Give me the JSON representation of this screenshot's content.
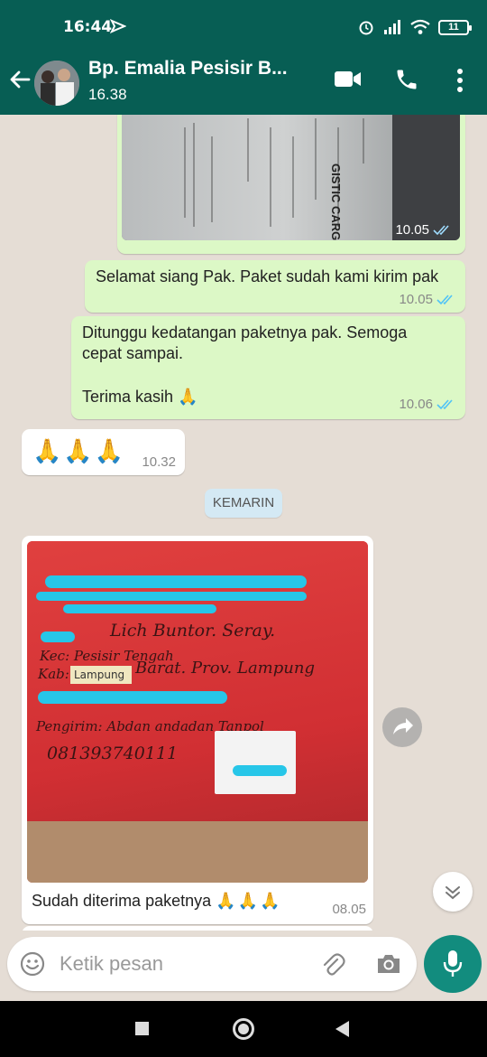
{
  "status_bar": {
    "time": "16:44",
    "battery": "11"
  },
  "header": {
    "contact_name": "Bp. Emalia Pesisir B...",
    "last_seen": "16.38"
  },
  "messages": [
    {
      "id": "doc-image",
      "direction": "out",
      "image": "shipping-document-photo",
      "doc_caption": "GISTIC CARGO",
      "time": "10.05",
      "ticks": "read"
    },
    {
      "id": "m1",
      "direction": "out",
      "text": "Selamat siang Pak. Paket sudah kami kirim pak",
      "time": "10.05",
      "ticks": "read"
    },
    {
      "id": "m2",
      "direction": "out",
      "text_line1": "Ditunggu kedatangan paketnya pak. Semoga",
      "text_line2": "cepat sampai.",
      "text_line3": "Terima kasih",
      "emoji": "🙏",
      "time": "10.06",
      "ticks": "read"
    },
    {
      "id": "m3",
      "direction": "in",
      "emoji": "🙏🙏🙏",
      "time": "10.32"
    },
    {
      "id": "m4",
      "direction": "in",
      "image": "red-parcel-photo",
      "caption": "Sudah diterima paketnya",
      "emoji": "🙏🙏🙏",
      "time": "08.05"
    }
  ],
  "date_separator": "KEMARIN",
  "parcel_handwriting": {
    "line1": "Lich Buntor. Seray.",
    "line2": "Kec: Pesisir Tengah",
    "line3": "Kab: ",
    "label": "Lampung",
    "line4": "Barat. Prov. Lampung",
    "line5": "Pengirim: Abdan andadan Tanpol",
    "line6": "081393740111"
  },
  "composer": {
    "placeholder": "Ketik pesan"
  },
  "icons": {
    "back": "arrow-left-icon",
    "video": "video-camera-icon",
    "call": "phone-icon",
    "menu": "more-vertical-icon",
    "emoji": "smiley-icon",
    "attach": "paperclip-icon",
    "camera": "camera-icon",
    "mic": "microphone-icon",
    "forward": "share-icon",
    "scroll": "chevron-down-double-icon"
  },
  "colors": {
    "header": "#075e54",
    "outgoing": "#dcf8c6",
    "incoming": "#ffffff",
    "chat_bg": "#e5ddd5",
    "accent": "#128c7e",
    "read_ticks": "#4fc3f7"
  }
}
